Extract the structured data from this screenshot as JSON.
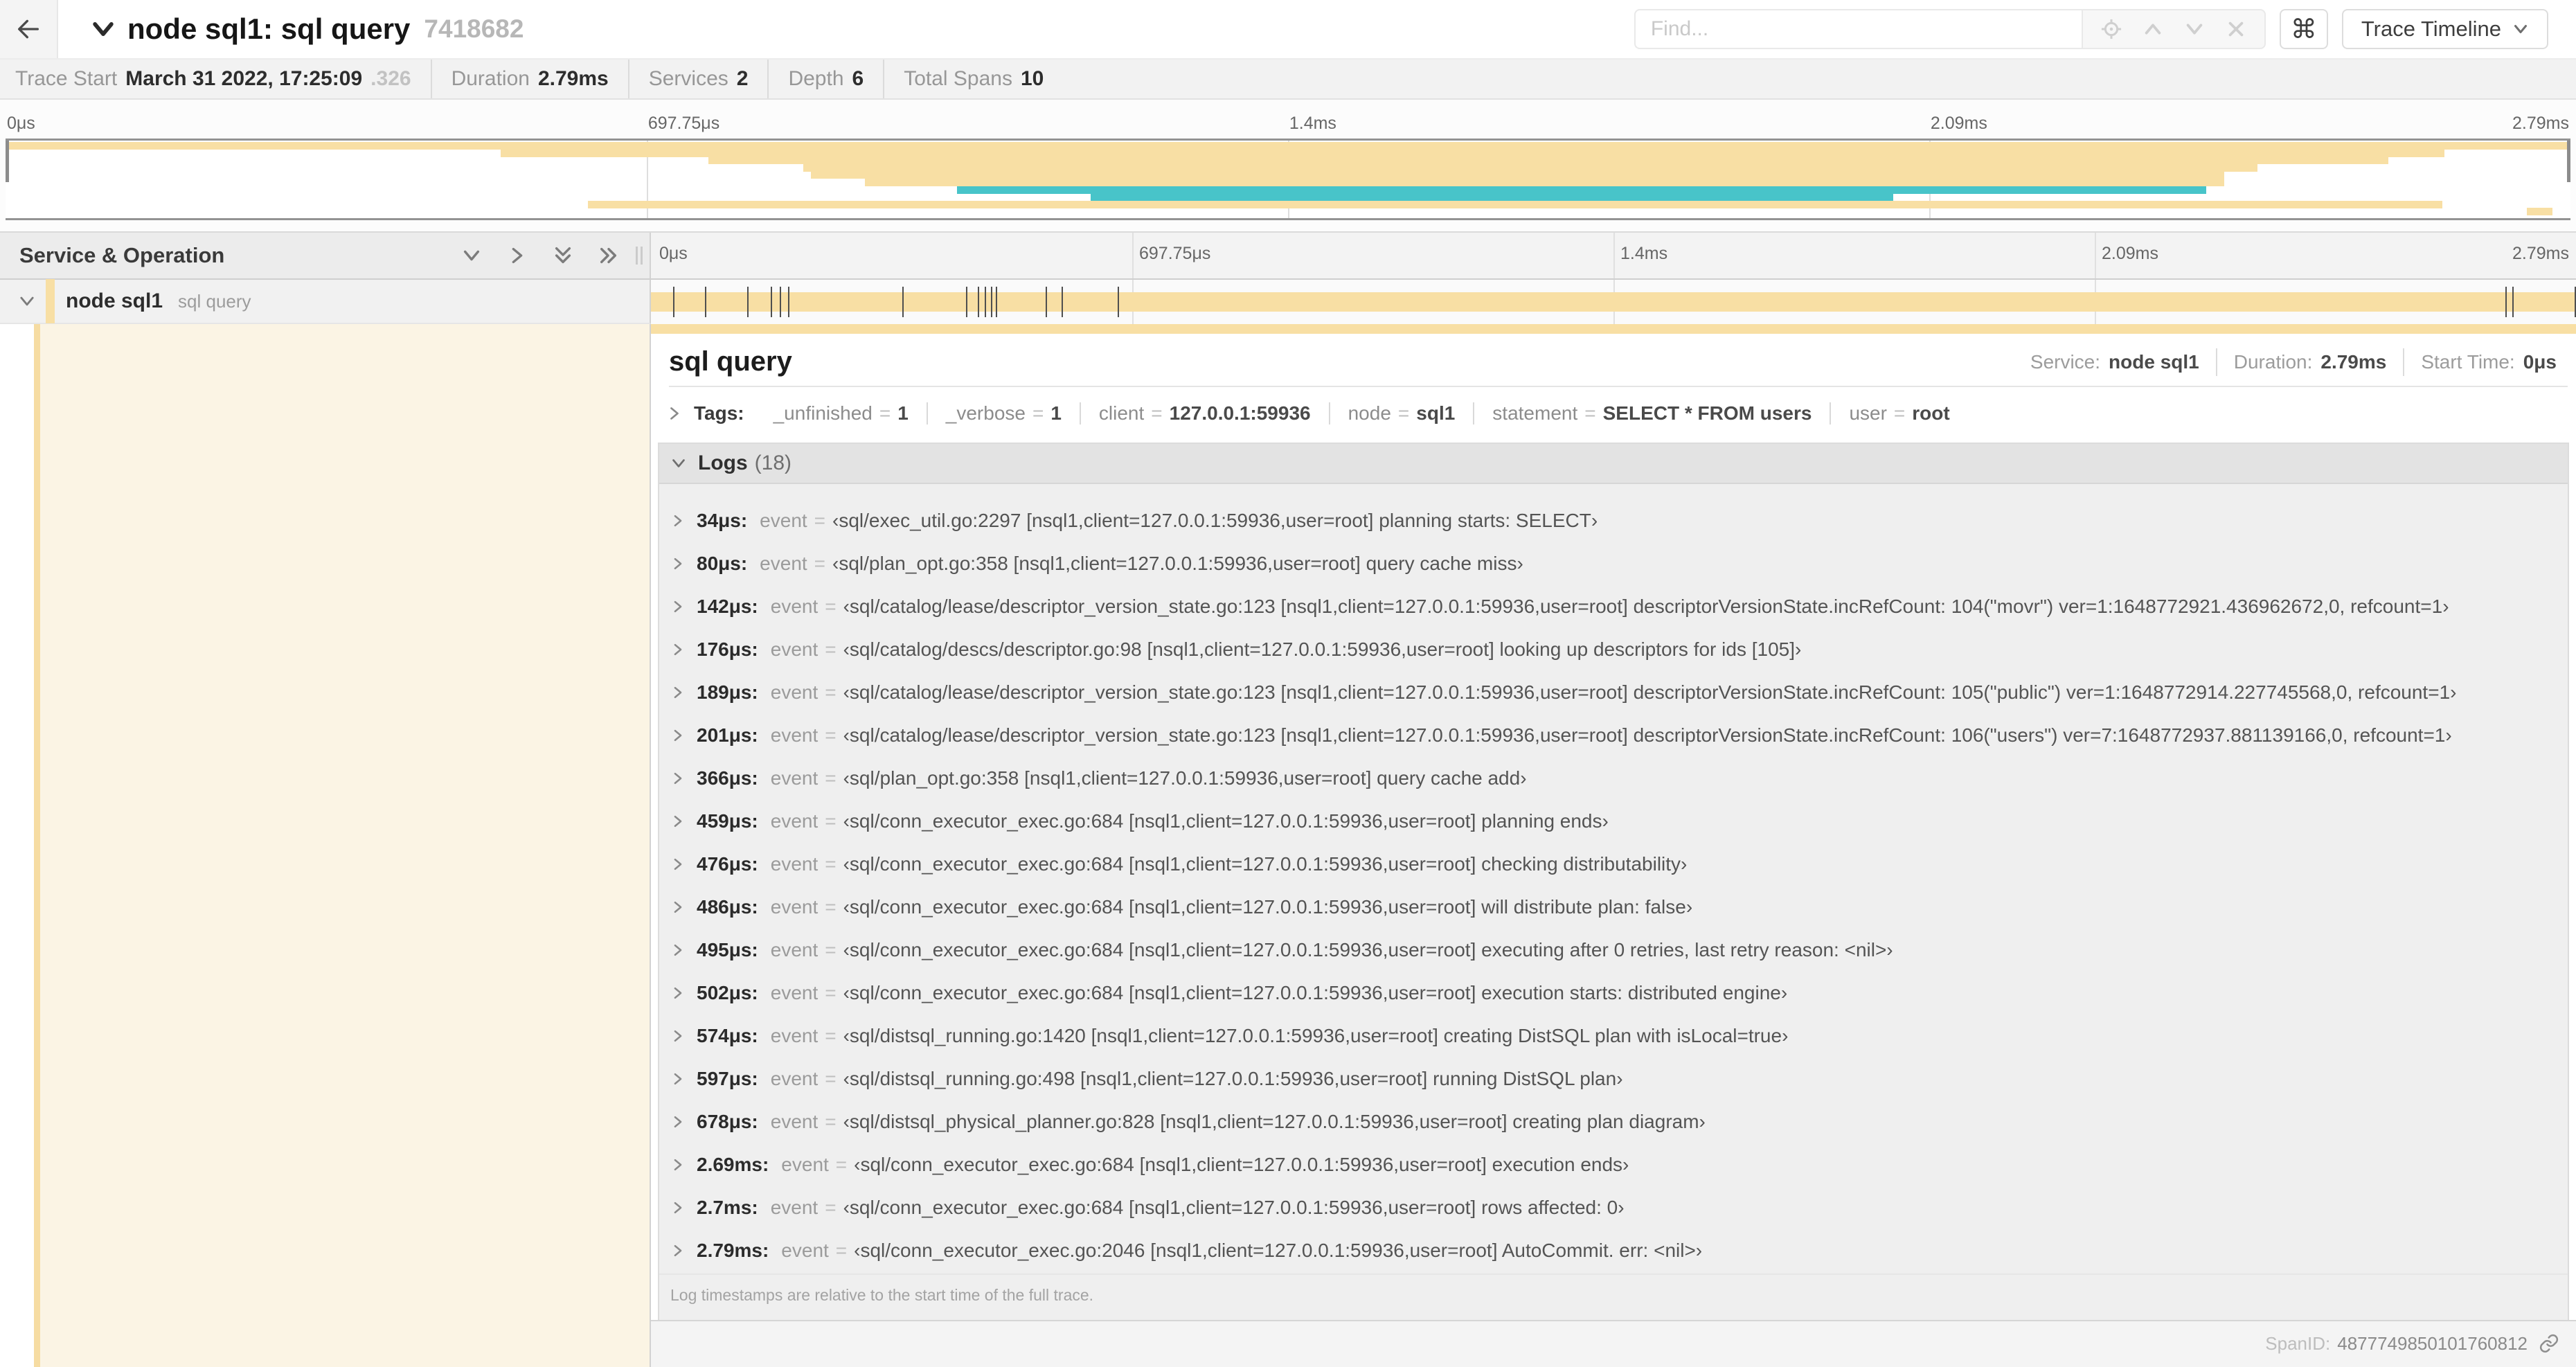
{
  "colors": {
    "tan": "#F8DFA4",
    "tan_stripe": "#F6DCA2",
    "tan_soft": "#FBF4E4",
    "teal": "#48C4C9"
  },
  "topbar": {
    "back": "←",
    "title": "node sql1: sql query",
    "trace_id": "7418682",
    "find_placeholder": "Find...",
    "shortcut": "⌘",
    "view_button": "Trace Timeline"
  },
  "meta": {
    "trace_start_label": "Trace Start",
    "trace_start": "March 31 2022, 17:25:09",
    "trace_start_suffix": ".326",
    "duration_label": "Duration",
    "duration": "2.79ms",
    "services_label": "Services",
    "services": "2",
    "depth_label": "Depth",
    "depth": "6",
    "total_spans_label": "Total Spans",
    "total_spans": "10"
  },
  "time_ticks": [
    "0μs",
    "697.75μs",
    "1.4ms",
    "2.09ms",
    "2.79ms"
  ],
  "minimap": {
    "spans": [
      {
        "row": 0,
        "left": 0,
        "width": 100,
        "color": "tan"
      },
      {
        "row": 1,
        "left": 19.3,
        "width": 75.8,
        "color": "tan"
      },
      {
        "row": 2,
        "left": 27.4,
        "width": 65.5,
        "color": "tan"
      },
      {
        "row": 3,
        "left": 31.1,
        "width": 56.7,
        "color": "tan"
      },
      {
        "row": 4,
        "left": 31.4,
        "width": 55.1,
        "color": "tan"
      },
      {
        "row": 5,
        "left": 33.5,
        "width": 53.0,
        "color": "tan"
      },
      {
        "row": 6,
        "left": 37.1,
        "width": 48.7,
        "color": "teal"
      },
      {
        "row": 7,
        "left": 42.3,
        "width": 31.3,
        "color": "teal"
      },
      {
        "row": 8,
        "left": 22.7,
        "width": 72.3,
        "color": "tan"
      },
      {
        "row": 9,
        "left": 98.3,
        "width": 1.0,
        "color": "tan"
      }
    ]
  },
  "timeline": {
    "header": "Service & Operation"
  },
  "span_row": {
    "service": "node sql1",
    "operation": "sql query"
  },
  "detail": {
    "title": "sql query",
    "overview": {
      "service_label": "Service:",
      "service": "node sql1",
      "duration_label": "Duration:",
      "duration": "2.79ms",
      "start_label": "Start Time:",
      "start": "0μs"
    },
    "tags_label": "Tags:",
    "tags": [
      {
        "key": "_unfinished",
        "eq": "=",
        "value": "1"
      },
      {
        "key": "_verbose",
        "eq": "=",
        "value": "1"
      },
      {
        "key": "client",
        "eq": "=",
        "value": "127.0.0.1:59936"
      },
      {
        "key": "node",
        "eq": "=",
        "value": "sql1"
      },
      {
        "key": "statement",
        "eq": "=",
        "value": "SELECT * FROM users"
      },
      {
        "key": "user",
        "eq": "=",
        "value": "root"
      }
    ],
    "logs_label": "Logs",
    "logs_count": "(18)",
    "logs": [
      {
        "time": "34μs:",
        "key": "event",
        "eq": "=",
        "msg": "‹sql/exec_util.go:2297 [nsql1,client=127.0.0.1:59936,user=root] planning starts: SELECT›"
      },
      {
        "time": "80μs:",
        "key": "event",
        "eq": "=",
        "msg": "‹sql/plan_opt.go:358 [nsql1,client=127.0.0.1:59936,user=root] query cache miss›"
      },
      {
        "time": "142μs:",
        "key": "event",
        "eq": "=",
        "msg": "‹sql/catalog/lease/descriptor_version_state.go:123 [nsql1,client=127.0.0.1:59936,user=root] descriptorVersionState.incRefCount: 104(\"movr\") ver=1:1648772921.436962672,0, refcount=1›"
      },
      {
        "time": "176μs:",
        "key": "event",
        "eq": "=",
        "msg": "‹sql/catalog/descs/descriptor.go:98 [nsql1,client=127.0.0.1:59936,user=root] looking up descriptors for ids [105]›"
      },
      {
        "time": "189μs:",
        "key": "event",
        "eq": "=",
        "msg": "‹sql/catalog/lease/descriptor_version_state.go:123 [nsql1,client=127.0.0.1:59936,user=root] descriptorVersionState.incRefCount: 105(\"public\") ver=1:1648772914.227745568,0, refcount=1›"
      },
      {
        "time": "201μs:",
        "key": "event",
        "eq": "=",
        "msg": "‹sql/catalog/lease/descriptor_version_state.go:123 [nsql1,client=127.0.0.1:59936,user=root] descriptorVersionState.incRefCount: 106(\"users\") ver=7:1648772937.881139166,0, refcount=1›"
      },
      {
        "time": "366μs:",
        "key": "event",
        "eq": "=",
        "msg": "‹sql/plan_opt.go:358 [nsql1,client=127.0.0.1:59936,user=root] query cache add›"
      },
      {
        "time": "459μs:",
        "key": "event",
        "eq": "=",
        "msg": "‹sql/conn_executor_exec.go:684 [nsql1,client=127.0.0.1:59936,user=root] planning ends›"
      },
      {
        "time": "476μs:",
        "key": "event",
        "eq": "=",
        "msg": "‹sql/conn_executor_exec.go:684 [nsql1,client=127.0.0.1:59936,user=root] checking distributability›"
      },
      {
        "time": "486μs:",
        "key": "event",
        "eq": "=",
        "msg": "‹sql/conn_executor_exec.go:684 [nsql1,client=127.0.0.1:59936,user=root] will distribute plan: false›"
      },
      {
        "time": "495μs:",
        "key": "event",
        "eq": "=",
        "msg": "‹sql/conn_executor_exec.go:684 [nsql1,client=127.0.0.1:59936,user=root] executing after 0 retries, last retry reason: <nil>›"
      },
      {
        "time": "502μs:",
        "key": "event",
        "eq": "=",
        "msg": "‹sql/conn_executor_exec.go:684 [nsql1,client=127.0.0.1:59936,user=root] execution starts: distributed engine›"
      },
      {
        "time": "574μs:",
        "key": "event",
        "eq": "=",
        "msg": "‹sql/distsql_running.go:1420 [nsql1,client=127.0.0.1:59936,user=root] creating DistSQL plan with isLocal=true›"
      },
      {
        "time": "597μs:",
        "key": "event",
        "eq": "=",
        "msg": "‹sql/distsql_running.go:498 [nsql1,client=127.0.0.1:59936,user=root] running DistSQL plan›"
      },
      {
        "time": "678μs:",
        "key": "event",
        "eq": "=",
        "msg": "‹sql/distsql_physical_planner.go:828 [nsql1,client=127.0.0.1:59936,user=root] creating plan diagram›"
      },
      {
        "time": "2.69ms:",
        "key": "event",
        "eq": "=",
        "msg": "‹sql/conn_executor_exec.go:684 [nsql1,client=127.0.0.1:59936,user=root] execution ends›"
      },
      {
        "time": "2.7ms:",
        "key": "event",
        "eq": "=",
        "msg": "‹sql/conn_executor_exec.go:684 [nsql1,client=127.0.0.1:59936,user=root] rows affected: 0›"
      },
      {
        "time": "2.79ms:",
        "key": "event",
        "eq": "=",
        "msg": "‹sql/conn_executor_exec.go:2046 [nsql1,client=127.0.0.1:59936,user=root] AutoCommit. err: <nil>›"
      }
    ],
    "logs_note": "Log timestamps are relative to the start time of the full trace.",
    "span_id_label": "SpanID:",
    "span_id": "4877749850101760812"
  }
}
